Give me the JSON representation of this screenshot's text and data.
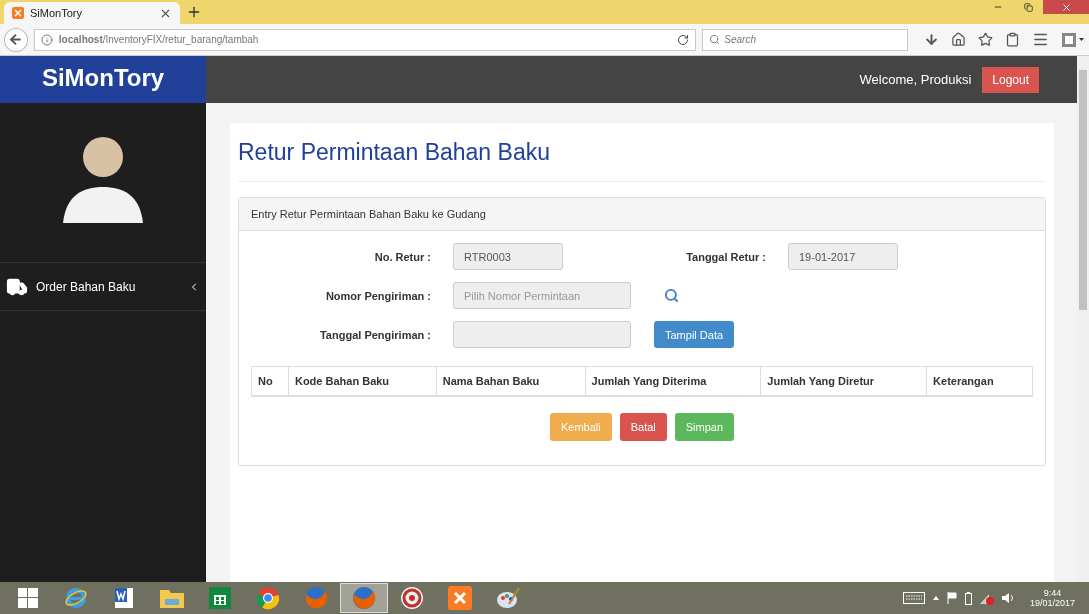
{
  "browser": {
    "tab_title": "SiMonTory",
    "url": "**localhost**/InventoryFIX/retur_barang/tambah",
    "search_placeholder": "Search"
  },
  "app": {
    "brand": "SiMonTory",
    "welcome": "Welcome, Produksi",
    "logout": "Logout"
  },
  "sidebar": {
    "items": [
      {
        "label": "Order Bahan Baku",
        "expanded": false
      }
    ]
  },
  "page": {
    "title": "Retur Permintaan Bahan Baku",
    "panel": {
      "heading": "Entry Retur Permintaan Bahan Baku ke Gudang",
      "rows": [
        {
          "fields": [
            {
              "label": "No. Retur :",
              "value": "RTR0003"
            },
            {
              "label": "Tanggal Retur :",
              "value": "19-01-2017"
            }
          ]
        },
        {
          "fields": [
            {
              "label": "Nomor Pengiriman :",
              "placeholder": "Pilih Nomor Permintaan"
            }
          ],
          "action": {
            "kind": "search"
          }
        },
        {
          "fields": [
            {
              "label": "Tanggal Pengiriman :"
            }
          ],
          "action": {
            "kind": "button",
            "label": "Tampil Data"
          }
        }
      ],
      "table": {
        "columns": [
          "No",
          "Kode Bahan Baku",
          "Nama Bahan Baku",
          "Jumlah Yang Diterima",
          "Jumlah Yang Diretur",
          "Keterangan"
        ]
      },
      "buttons": [
        {
          "label": "Kembali",
          "kind": "warning"
        },
        {
          "label": "Batal",
          "kind": "danger"
        },
        {
          "label": "Simpan",
          "kind": "success"
        }
      ]
    }
  },
  "taskbar": {
    "apps": [
      {
        "kind": "ie",
        "selected": false
      },
      {
        "kind": "word",
        "selected": false
      },
      {
        "kind": "folder",
        "selected": false
      },
      {
        "kind": "store",
        "selected": false
      },
      {
        "kind": "chrome",
        "selected": false
      },
      {
        "kind": "firefox",
        "selected": false
      },
      {
        "kind": "firefox",
        "selected": true
      },
      {
        "kind": "redapp",
        "selected": false
      },
      {
        "kind": "xampp",
        "selected": false
      },
      {
        "kind": "paint",
        "selected": false
      }
    ],
    "time": "9:44",
    "date": "19/01/2017"
  }
}
